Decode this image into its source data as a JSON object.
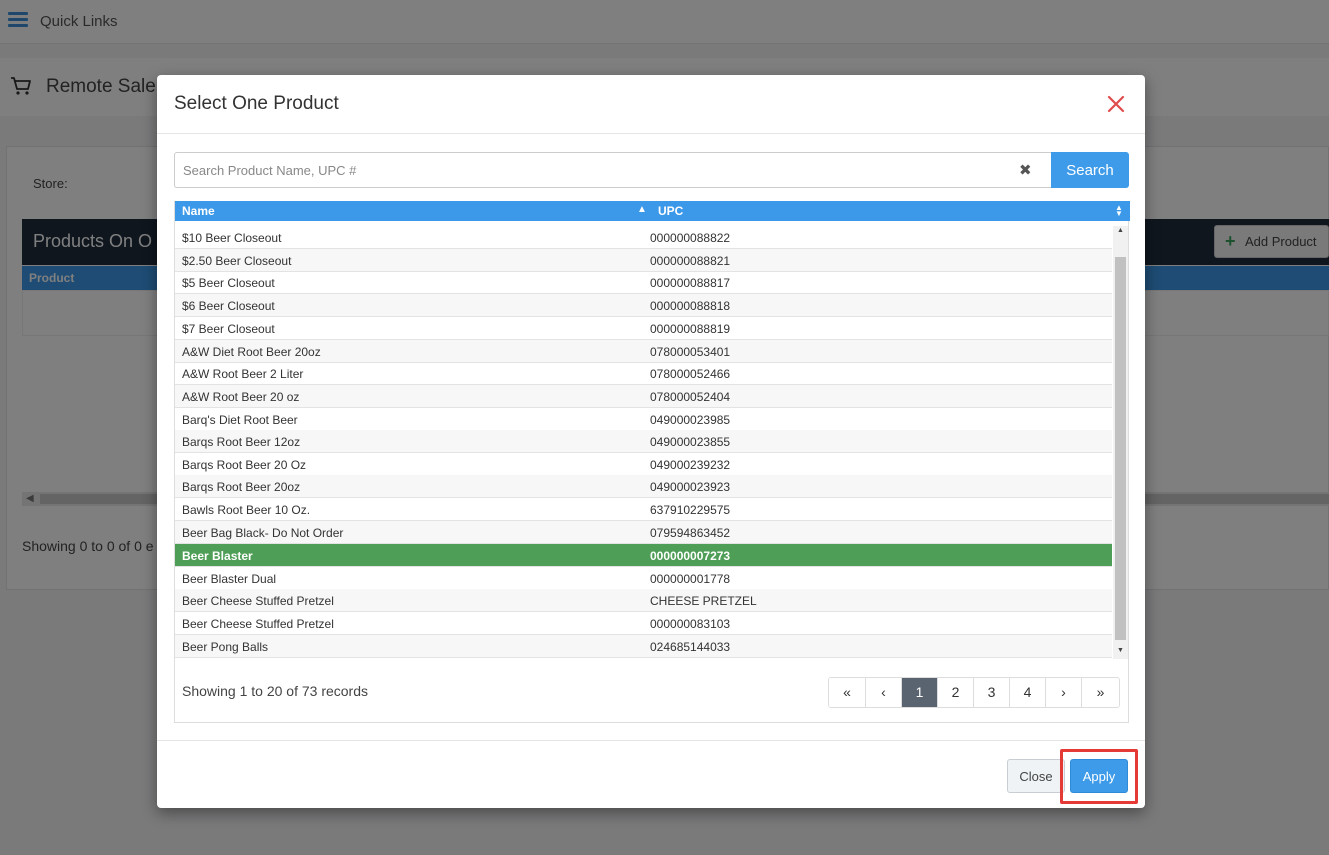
{
  "background": {
    "quick_links": "Quick Links",
    "page_title": "Remote Sale",
    "store_label": "Store:",
    "products_title": "Products On O",
    "add_product": "Add Product",
    "table_header": "Product",
    "showing": "Showing 0 to 0 of 0 e"
  },
  "modal": {
    "title": "Select One Product",
    "search": {
      "placeholder": "Search Product Name, UPC #",
      "value": "",
      "button_label": "Search"
    },
    "columns": {
      "name": "Name",
      "upc": "UPC"
    },
    "rows": [
      {
        "name": "$10 Beer Closeout",
        "upc": "000000088822"
      },
      {
        "name": "$2.50 Beer Closeout",
        "upc": "000000088821"
      },
      {
        "name": "$5 Beer Closeout",
        "upc": "000000088817"
      },
      {
        "name": "$6 Beer Closeout",
        "upc": "000000088818"
      },
      {
        "name": "$7 Beer Closeout",
        "upc": "000000088819"
      },
      {
        "name": "A&W Diet Root Beer 20oz",
        "upc": "078000053401"
      },
      {
        "name": "A&W Root Beer 2 Liter",
        "upc": "078000052466"
      },
      {
        "name": "A&W Root Beer 20 oz",
        "upc": "078000052404"
      },
      {
        "name": "Barq's Diet Root Beer",
        "upc": "049000023985"
      },
      {
        "name": "Barqs Root Beer 12oz",
        "upc": "049000023855"
      },
      {
        "name": "Barqs Root Beer 20 Oz",
        "upc": "049000239232"
      },
      {
        "name": "Barqs Root Beer 20oz",
        "upc": "049000023923"
      },
      {
        "name": "Bawls Root Beer 10 Oz.",
        "upc": "637910229575"
      },
      {
        "name": "Beer Bag Black- Do Not Order",
        "upc": "079594863452"
      },
      {
        "name": "Beer Blaster",
        "upc": "000000007273"
      },
      {
        "name": "Beer Blaster Dual",
        "upc": "000000001778"
      },
      {
        "name": "Beer Cheese Stuffed Pretzel",
        "upc": "CHEESE PRETZEL"
      },
      {
        "name": "Beer Cheese Stuffed Pretzel",
        "upc": "000000083103"
      },
      {
        "name": "Beer Pong Balls",
        "upc": "024685144033"
      }
    ],
    "records_info": "Showing 1 to 20 of 73 records",
    "pagination": {
      "first": "«",
      "prev": "‹",
      "pages": [
        "1",
        "2",
        "3",
        "4"
      ],
      "next": "›",
      "last": "»",
      "active_page": "1"
    },
    "footer": {
      "close_label": "Close",
      "apply_label": "Apply"
    }
  },
  "colors": {
    "accent": "#3d9be9",
    "selected_row": "#4f9e57",
    "highlight": "#e53935"
  }
}
